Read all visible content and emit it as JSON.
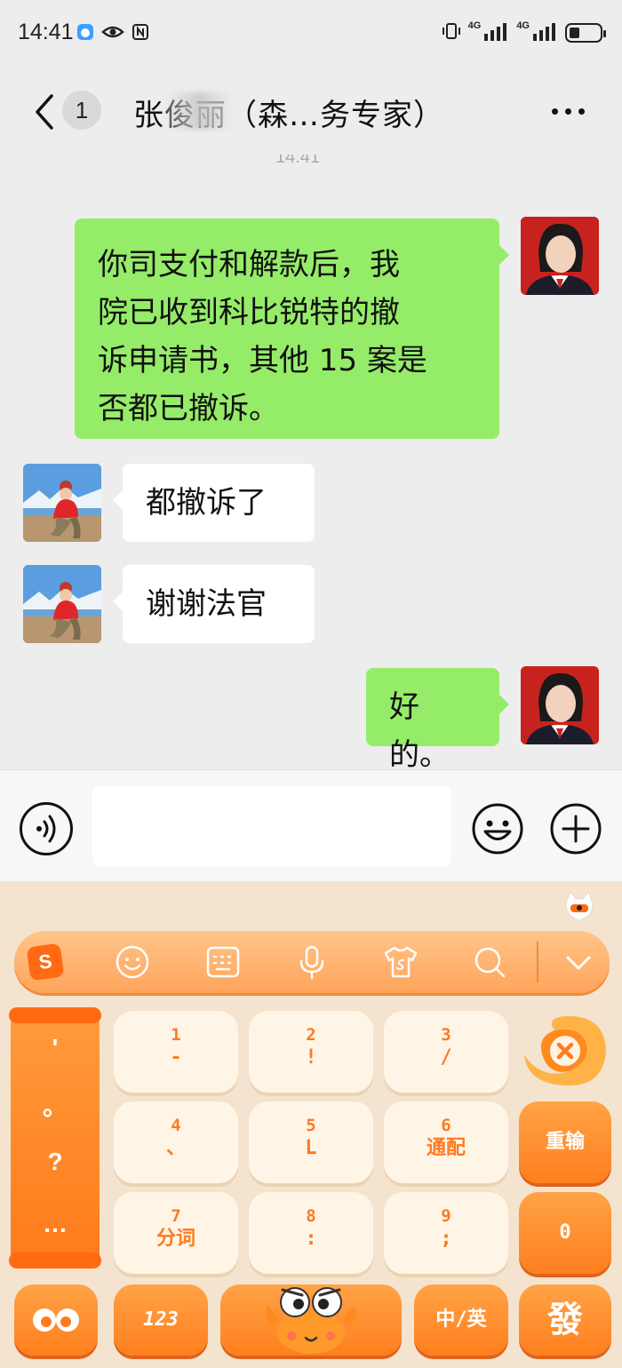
{
  "status_bar": {
    "time": "14:41",
    "network_label_1": "4G",
    "network_label_2": "4G",
    "battery_level": 0.35
  },
  "header": {
    "unread_count": "1",
    "title": "张俊丽（森…务专家）"
  },
  "chat": {
    "partial_timestamp": "14:41",
    "messages": [
      {
        "sender": "self",
        "text_lines": [
          "你司支付和解款后，我",
          "院已收到科比锐特的撤",
          "诉申请书，其他 15 案是",
          "否都已撤诉。"
        ]
      },
      {
        "sender": "other",
        "text": "都撤诉了"
      },
      {
        "sender": "other",
        "text": "谢谢法官"
      },
      {
        "sender": "self",
        "text": "好的。"
      }
    ]
  },
  "input_bar": {
    "placeholder": ""
  },
  "keyboard": {
    "toolbar_logo": "S",
    "punctuation": [
      "'",
      "。",
      "?",
      "…"
    ],
    "keys": [
      {
        "num": "1",
        "sub": "-"
      },
      {
        "num": "2",
        "sub": "!"
      },
      {
        "num": "3",
        "sub": "/"
      },
      {
        "num": "4",
        "sub": "、"
      },
      {
        "num": "5",
        "sub": "L"
      },
      {
        "num": "6",
        "sub": "通配"
      },
      {
        "num": "7",
        "sub": "分词"
      },
      {
        "num": "8",
        "sub": ":"
      },
      {
        "num": "9",
        "sub": ";"
      }
    ],
    "reinput_label": "重输",
    "zero_label": "0",
    "bottom": {
      "mode_label": "123",
      "lang_label": "中/英",
      "send_label": "發"
    }
  },
  "colors": {
    "self_bubble": "#95ec69",
    "other_bubble": "#ffffff",
    "keyboard_accent": "#ff7f1e"
  }
}
